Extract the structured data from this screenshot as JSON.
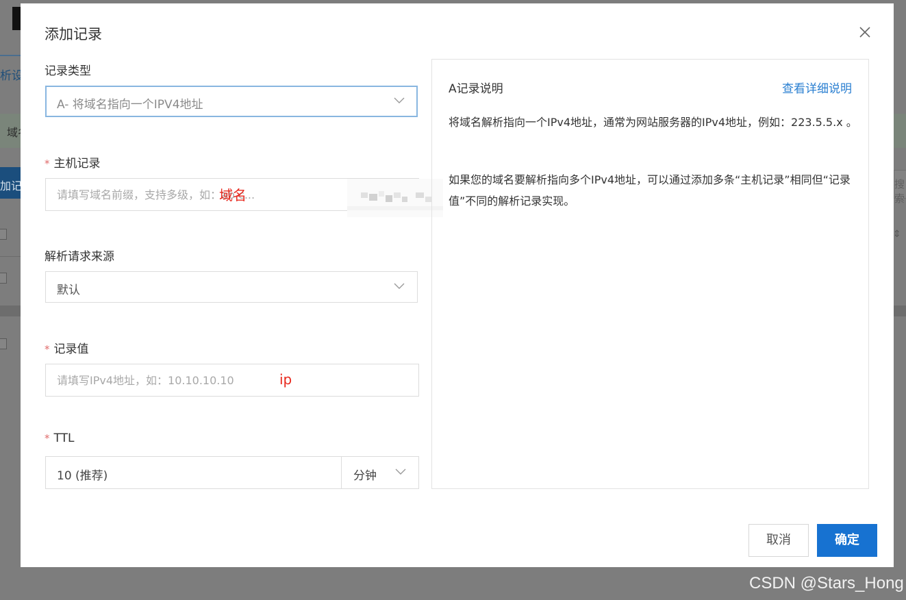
{
  "background": {
    "tab_label": "析设",
    "banner_text": "域名",
    "add_button_label": "加记",
    "right_input_text": "搜索",
    "watermark": "CSDN @Stars_Hong"
  },
  "dialog": {
    "title": "添加记录",
    "record_type": {
      "label": "记录类型",
      "value": "A- 将域名指向一个IPV4地址"
    },
    "host_record": {
      "label": "主机记录",
      "placeholder": "请填写域名前缀，支持多级，如：ab.c...",
      "annotation": "域名"
    },
    "resolve_source": {
      "label": "解析请求来源",
      "value": "默认"
    },
    "record_value": {
      "label": "记录值",
      "placeholder": "请填写IPv4地址，如：10.10.10.10",
      "annotation": "ip"
    },
    "ttl": {
      "label": "TTL",
      "value": "10 (推荐)",
      "unit": "分钟"
    },
    "help": {
      "title": "A记录说明",
      "link": "查看详细说明",
      "paragraph1": "将域名解析指向一个IPv4地址，通常为网站服务器的IPv4地址，例如：223.5.5.x 。",
      "paragraph2": "如果您的域名要解析指向多个IPv4地址，可以通过添加多条“主机记录”相同但“记录值”不同的解析记录实现。"
    },
    "buttons": {
      "cancel": "取消",
      "confirm": "确定"
    }
  },
  "colors": {
    "primary": "#1772d1",
    "link": "#2a7fd1",
    "required": "#e06b6b",
    "annotation": "#e8281d",
    "overlay": "#7f7f7f"
  },
  "icons": {
    "close": "close-icon",
    "dropdown": "chevron-down-icon"
  }
}
